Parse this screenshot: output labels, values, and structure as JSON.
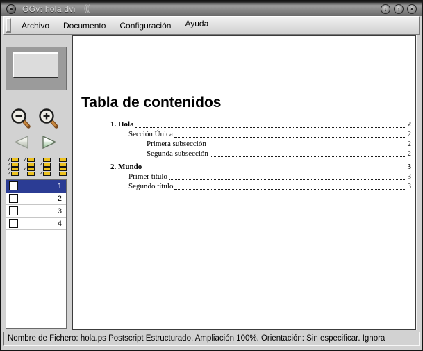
{
  "window": {
    "title": "GGv: hola.dvi",
    "decoration": "(((",
    "controls": [
      {
        "name": "minimize",
        "glyph": "↓"
      },
      {
        "name": "maximize",
        "glyph": "↑"
      },
      {
        "name": "close",
        "glyph": "×"
      }
    ]
  },
  "menu": {
    "items": [
      {
        "name": "menu-archivo",
        "label": "Archivo",
        "raised": false
      },
      {
        "name": "menu-documento",
        "label": "Documento",
        "raised": false
      },
      {
        "name": "menu-configuracion",
        "label": "Configuración",
        "raised": false
      },
      {
        "name": "menu-ayuda",
        "label": "Ayuda",
        "raised": true
      }
    ]
  },
  "sidebar": {
    "toolbar": {
      "zoom_out": "zoom-out",
      "zoom_in": "zoom-in",
      "prev_page": "previous-page",
      "next_page": "next-page",
      "page_toggles": [
        {
          "name": "toggle-all-pages",
          "pattern": [
            1,
            1,
            1,
            1
          ]
        },
        {
          "name": "toggle-odd-pages",
          "pattern": [
            1,
            0,
            1,
            0
          ]
        },
        {
          "name": "toggle-even-pages",
          "pattern": [
            0,
            1,
            0,
            1
          ]
        },
        {
          "name": "clear-all-pages",
          "pattern": [
            0,
            0,
            0,
            0
          ]
        }
      ]
    },
    "page_list": {
      "selected_index": 0,
      "pages": [
        {
          "number": "1",
          "checked": false
        },
        {
          "number": "2",
          "checked": false
        },
        {
          "number": "3",
          "checked": false
        },
        {
          "number": "4",
          "checked": false
        }
      ]
    }
  },
  "document": {
    "title": "Tabla de contenidos",
    "toc": [
      {
        "label": "1. Hola",
        "level": 0,
        "page": "2",
        "bold": true
      },
      {
        "label": "Sección Única",
        "level": 1,
        "page": "2",
        "bold": false
      },
      {
        "label": "Primera subsección",
        "level": 2,
        "page": "2",
        "bold": false
      },
      {
        "label": "Segunda subsección",
        "level": 2,
        "page": "2",
        "bold": false
      },
      {
        "label": "2. Mundo",
        "level": 0,
        "page": "3",
        "bold": true
      },
      {
        "label": "Primer título",
        "level": 1,
        "page": "3",
        "bold": false
      },
      {
        "label": "Segundo título",
        "level": 1,
        "page": "3",
        "bold": false
      }
    ]
  },
  "statusbar": {
    "text": "Nombre de Fichero: hola.ps Postscript Estructurado. Ampliación 100%. Orientación: Sin especificar. Ignora"
  },
  "colors": {
    "selection": "#2b3c94",
    "toggle_yellow": "#ecc11f",
    "titlebar_gray": "#7e7e7e"
  }
}
